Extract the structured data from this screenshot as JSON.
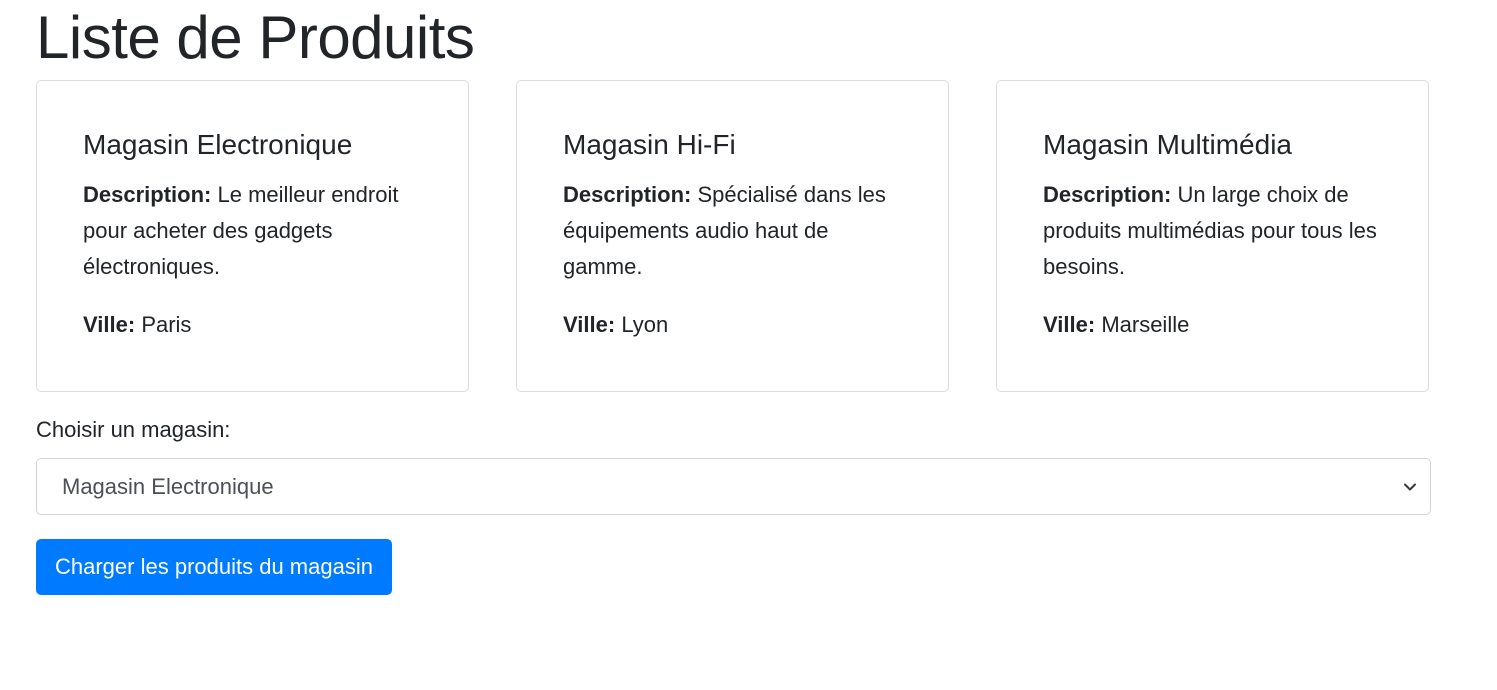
{
  "page": {
    "title": "Liste de Produits"
  },
  "stores": [
    {
      "name": "Magasin Electronique",
      "description_label": "Description:",
      "description": "Le meilleur endroit pour acheter des gadgets électroniques.",
      "city_label": "Ville:",
      "city": "Paris"
    },
    {
      "name": "Magasin Hi-Fi",
      "description_label": "Description:",
      "description": "Spécialisé dans les équipements audio haut de gamme.",
      "city_label": "Ville:",
      "city": "Lyon"
    },
    {
      "name": "Magasin Multimédia",
      "description_label": "Description:",
      "description": "Un large choix de produits multimédias pour tous les besoins.",
      "city_label": "Ville:",
      "city": "Marseille"
    }
  ],
  "form": {
    "select_label": "Choisir un magasin:",
    "selected_store": "Magasin Electronique",
    "select_icon": "chevron-down-icon",
    "submit_label": "Charger les produits du magasin"
  },
  "colors": {
    "primary_button": "#007bff",
    "text": "#212529",
    "card_border": "#d9dcdf"
  }
}
